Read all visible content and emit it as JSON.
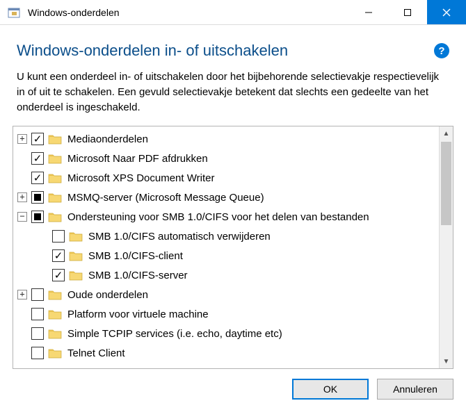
{
  "titlebar": {
    "title": "Windows-onderdelen"
  },
  "header": {
    "page_title": "Windows-onderdelen in- of uitschakelen",
    "help_label": "?"
  },
  "description": "U kunt een onderdeel in- of uitschakelen door het bijbehorende selectievakje respectievelijk in of uit te schakelen. Een gevuld selectievakje betekent dat slechts een gedeelte van het onderdeel is ingeschakeld.",
  "tree": [
    {
      "expander": "plus",
      "check": "checked",
      "label": "Mediaonderdelen",
      "indent": 0
    },
    {
      "expander": "none",
      "check": "checked",
      "label": "Microsoft Naar PDF afdrukken",
      "indent": 0
    },
    {
      "expander": "none",
      "check": "checked",
      "label": "Microsoft XPS Document Writer",
      "indent": 0
    },
    {
      "expander": "plus",
      "check": "partial",
      "label": "MSMQ-server (Microsoft Message Queue)",
      "indent": 0
    },
    {
      "expander": "minus",
      "check": "partial",
      "label": "Ondersteuning voor SMB 1.0/CIFS voor het delen van bestanden",
      "indent": 0
    },
    {
      "expander": "none",
      "check": "empty",
      "label": "SMB 1.0/CIFS automatisch verwijderen",
      "indent": 1
    },
    {
      "expander": "none",
      "check": "checked",
      "label": "SMB 1.0/CIFS-client",
      "indent": 1
    },
    {
      "expander": "none",
      "check": "checked",
      "label": "SMB 1.0/CIFS-server",
      "indent": 1
    },
    {
      "expander": "plus",
      "check": "empty",
      "label": "Oude onderdelen",
      "indent": 0
    },
    {
      "expander": "none",
      "check": "empty",
      "label": "Platform voor virtuele machine",
      "indent": 0
    },
    {
      "expander": "none",
      "check": "empty",
      "label": "Simple TCPIP services (i.e. echo, daytime etc)",
      "indent": 0
    },
    {
      "expander": "none",
      "check": "empty",
      "label": "Telnet Client",
      "indent": 0
    }
  ],
  "footer": {
    "ok": "OK",
    "cancel": "Annuleren"
  }
}
